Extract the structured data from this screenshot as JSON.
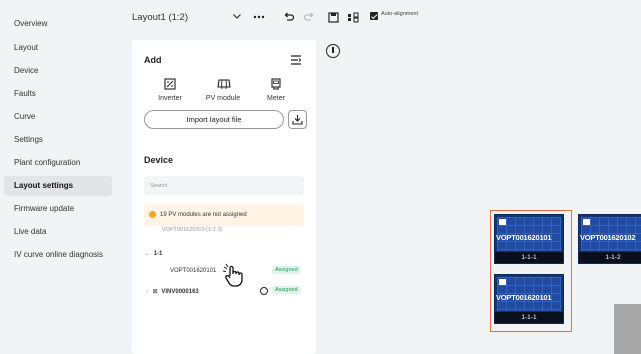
{
  "sidebar": {
    "items": [
      {
        "label": "Overview"
      },
      {
        "label": "Layout"
      },
      {
        "label": "Device"
      },
      {
        "label": "Faults"
      },
      {
        "label": "Curve"
      },
      {
        "label": "Settings"
      },
      {
        "label": "Plant configuration"
      },
      {
        "label": "Layout settings",
        "active": true
      },
      {
        "label": "Firmware update"
      },
      {
        "label": "Live data"
      },
      {
        "label": "IV curve online diagnosis"
      }
    ]
  },
  "toolbar": {
    "layout_value": "Layout1 (1:2)",
    "more_icon": "more-icon",
    "undo_icon": "undo-icon",
    "redo_icon": "redo-icon",
    "save_icon": "save-icon",
    "layers_icon": "layers-icon",
    "auto_alignment_label": "Auto-alignment",
    "auto_alignment_checked": true
  },
  "add_panel": {
    "title": "Add",
    "tools": [
      {
        "label": "Inverter",
        "icon": "inverter-icon"
      },
      {
        "label": "PV module",
        "icon": "pv-module-icon"
      },
      {
        "label": "Meter",
        "icon": "meter-icon"
      }
    ],
    "import_label": "Import layout file"
  },
  "device_panel": {
    "title": "Device",
    "search_placeholder": "Search",
    "warning_text": "19 PV modules are not assigned",
    "partial_row": "VOPT001620203 (1-2-3)",
    "group_label": "1-1",
    "module_sn": "VOPT001620101",
    "module_status": "Assigned",
    "inverter_sn": "VINV0000163",
    "inverter_status": "Assigned"
  },
  "canvas": {
    "modules": [
      {
        "sn": "VOPT001620101",
        "id": "1-1-1"
      },
      {
        "sn": "VOPT001620102",
        "id": "1-1-2"
      },
      {
        "sn": "VOPT001620101",
        "id": "1-1-1"
      }
    ]
  },
  "colors": {
    "selection": "#e86b4a",
    "module_blue": "#17336e",
    "assigned_green": "#1a9d55",
    "warning_bg": "#fff4e5"
  }
}
